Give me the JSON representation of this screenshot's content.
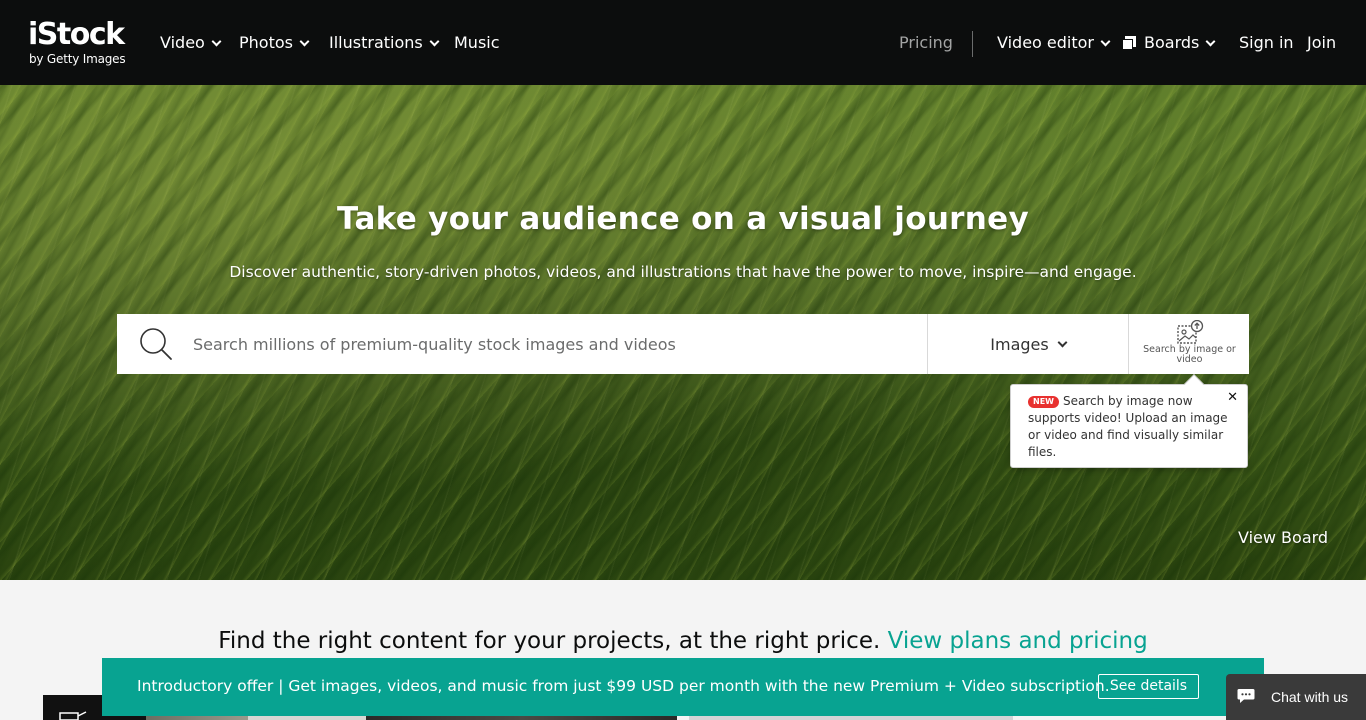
{
  "header": {
    "logo": {
      "main": "iStock",
      "sub": "by Getty Images"
    },
    "nav_left": [
      "Video",
      "Photos",
      "Illustrations",
      "Music"
    ],
    "pricing": "Pricing",
    "video_editor": "Video editor",
    "boards": "Boards",
    "sign_in": "Sign in",
    "join": "Join"
  },
  "hero": {
    "title": "Take your audience on a visual journey",
    "subtitle": "Discover authentic, story-driven photos, videos, and illustrations that have the power to move, inspire—and engage.",
    "search": {
      "placeholder": "Search millions of premium-quality stock images and videos",
      "type_selected": "Images",
      "image_search_label": "Search by image or video"
    },
    "tooltip": {
      "badge": "NEW",
      "text": "Search by image now supports video! Upload an image or video and find visually similar files.",
      "close": "✕"
    },
    "view_board": "View Board"
  },
  "pricing_line": {
    "text": "Find the right content for your projects, at the right price.",
    "link": "View plans and pricing"
  },
  "promo": {
    "text": "Introductory offer | Get images, videos, and music from just $99 USD per month with the new Premium + Video subscription.",
    "button": "See details"
  },
  "chat": {
    "label": "Chat with us"
  },
  "colors": {
    "header_bg": "#0c0d0d",
    "accent_teal": "#08a391",
    "badge_red": "#e8312f",
    "chat_bg": "#3a3a3a"
  },
  "icons": [
    "search-icon",
    "chevron-down-icon",
    "boards-icon",
    "image-search-icon",
    "close-icon",
    "chat-bubble-icon"
  ]
}
